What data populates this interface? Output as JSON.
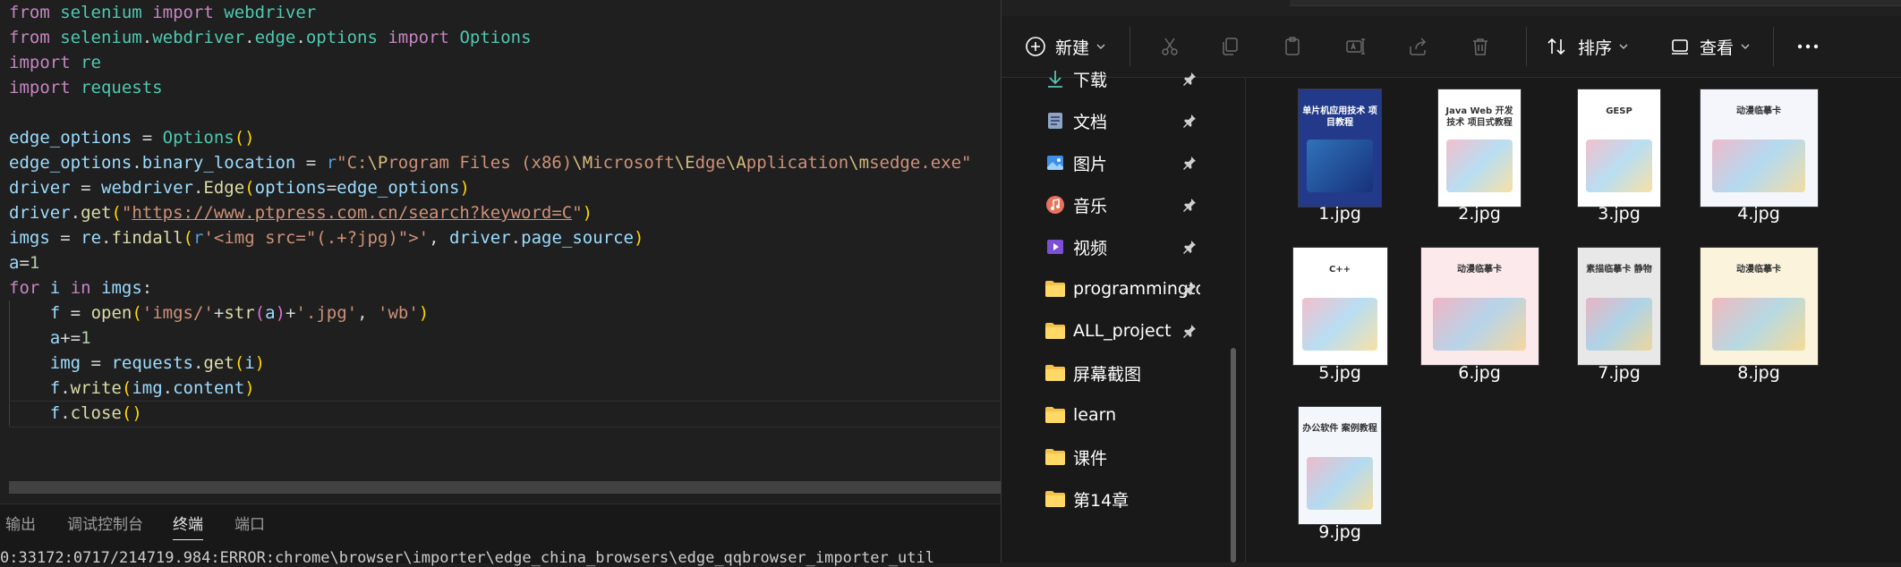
{
  "editor": {
    "lines": [
      "from selenium import webdriver",
      "from selenium.webdriver.edge.options import Options",
      "import re",
      "import requests",
      "",
      "edge_options = Options()",
      "edge_options.binary_location = r\"C:\\Program Files (x86)\\Microsoft\\Edge\\Application\\msedge.exe\"",
      "driver = webdriver.Edge(options=edge_options)",
      "driver.get(\"https://www.ptpress.com.cn/search?keyword=C\")",
      "imgs = re.findall(r'<img src=\"(.+?jpg)\">', driver.page_source)",
      "a=1",
      "for i in imgs:",
      "    f = open('imgs/'+str(a)+'.jpg', 'wb')",
      "    a+=1",
      "    img = requests.get(i)",
      "    f.write(img.content)",
      "    f.close()"
    ]
  },
  "panel": {
    "tabs": [
      "输出",
      "调试控制台",
      "终端",
      "端口"
    ],
    "active_tab": "终端",
    "terminal_text": "0:33172:0717/214719.984:ERROR:chrome\\browser\\importer\\edge_china_browsers\\edge_qqbrowser_importer_util"
  },
  "explorer": {
    "toolbar": {
      "new_label": "新建",
      "sort_label": "排序",
      "view_label": "查看",
      "more_label": "…"
    },
    "nav_items": [
      {
        "label": "下载",
        "icon": "download-icon",
        "pinned": true
      },
      {
        "label": "文档",
        "icon": "document-icon",
        "pinned": true
      },
      {
        "label": "图片",
        "icon": "pictures-icon",
        "pinned": true
      },
      {
        "label": "音乐",
        "icon": "music-icon",
        "pinned": true
      },
      {
        "label": "视频",
        "icon": "video-icon",
        "pinned": true
      },
      {
        "label": "programmingtools",
        "icon": "folder-icon",
        "pinned": true
      },
      {
        "label": "ALL_project",
        "icon": "folder-icon",
        "pinned": true
      },
      {
        "label": "屏幕截图",
        "icon": "folder-icon",
        "pinned": false
      },
      {
        "label": "learn",
        "icon": "folder-icon",
        "pinned": false
      },
      {
        "label": "课件",
        "icon": "folder-icon",
        "pinned": false
      },
      {
        "label": "第14章",
        "icon": "folder-icon",
        "pinned": false
      }
    ],
    "files": [
      {
        "name": "1.jpg",
        "cover_title": "单片机应用技术 项目教程",
        "cover_color": "#233a8a"
      },
      {
        "name": "2.jpg",
        "cover_title": "Java Web 开发技术 项目式教程",
        "cover_color": "#ffffff"
      },
      {
        "name": "3.jpg",
        "cover_title": "GESP",
        "cover_color": "#ffffff"
      },
      {
        "name": "4.jpg",
        "cover_title": "动漫临摹卡",
        "cover_color": "#f4f6fb"
      },
      {
        "name": "5.jpg",
        "cover_title": "C++",
        "cover_color": "#ffffff"
      },
      {
        "name": "6.jpg",
        "cover_title": "动漫临摹卡",
        "cover_color": "#fbe9ec"
      },
      {
        "name": "7.jpg",
        "cover_title": "素描临摹卡 静物",
        "cover_color": "#e8e8e8"
      },
      {
        "name": "8.jpg",
        "cover_title": "动漫临摹卡",
        "cover_color": "#fbf3dc"
      },
      {
        "name": "9.jpg",
        "cover_title": "办公软件 案例教程",
        "cover_color": "#f3f7fb"
      }
    ]
  }
}
